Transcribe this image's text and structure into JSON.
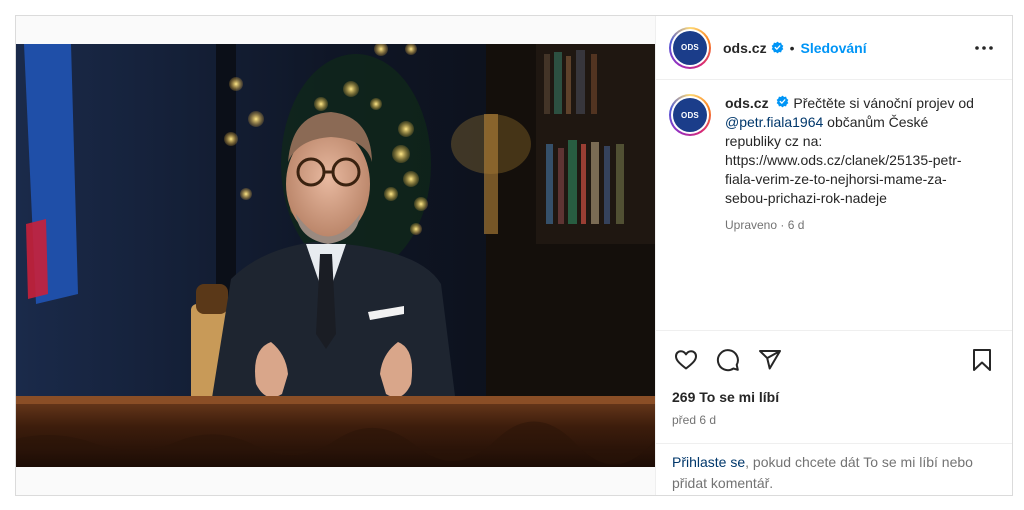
{
  "post": {
    "username": "ods.cz",
    "follow_label": "Sledování",
    "separator": "•",
    "avatar_text": "ODS",
    "caption": {
      "text_before": "Přečtěte si vánoční projev od",
      "mention": "@petr.fiala1964",
      "text_after": "občanům České republiky cz na: https://www.ods.cz/clanek/25135-petr-fiala-verim-ze-to-nejhorsi-mame-za-sebou-prichazi-rok-nadeje"
    },
    "caption_meta": "Upraveno · 6 d",
    "likes": "269 To se mi líbí",
    "posted_ago": "před 6 d",
    "login_prompt": {
      "link": "Přihlaste se",
      "text": ", pokud chcete dát To se mi líbí nebo přidat komentář."
    }
  },
  "icons": {
    "verified": "verified-badge-icon",
    "more": "more-options-icon",
    "like": "heart-icon",
    "comment": "comment-icon",
    "share": "share-icon",
    "save": "bookmark-icon"
  },
  "colors": {
    "accent": "#0095f6",
    "link": "#00376b",
    "border": "#dbdbdb",
    "muted": "#737373",
    "avatar_bg": "#1b3d8a"
  }
}
